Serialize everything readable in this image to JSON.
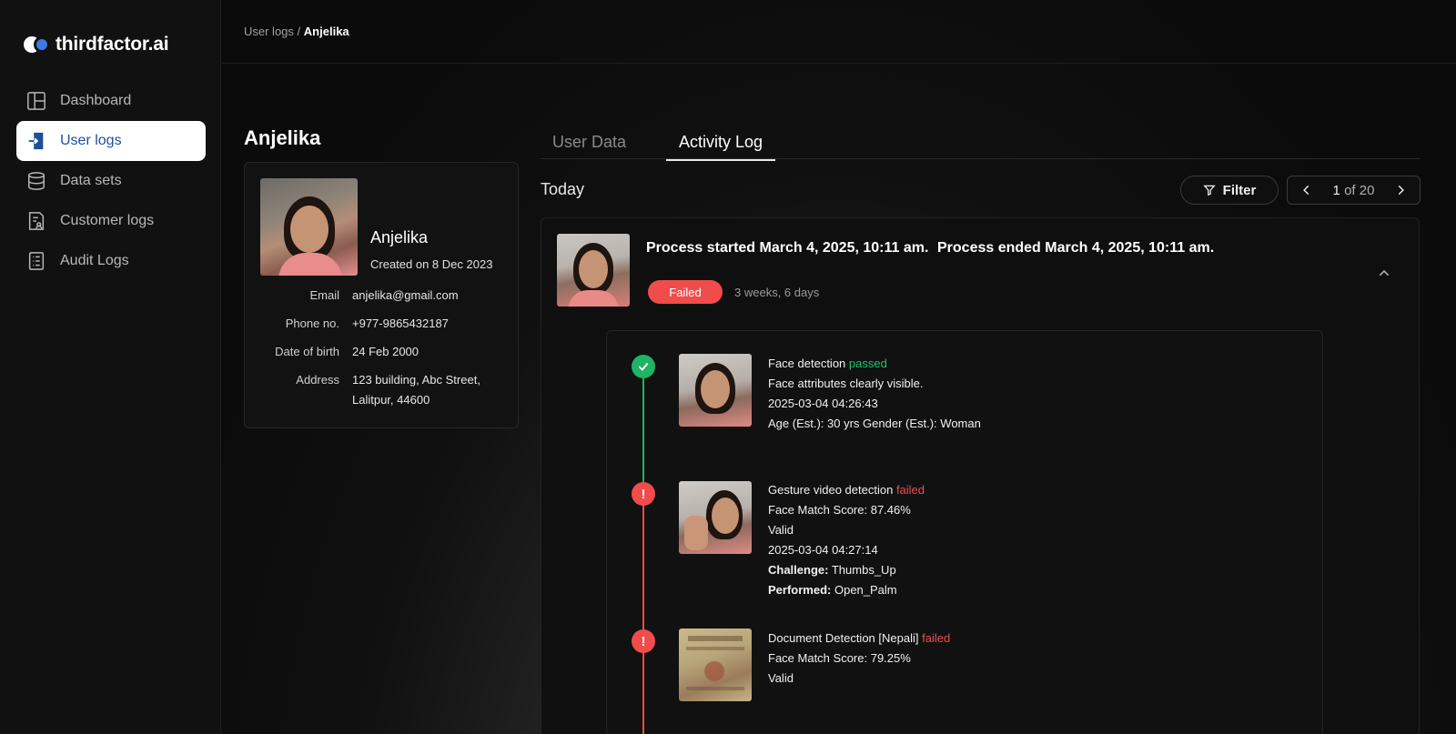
{
  "brand": {
    "name": "thirdfactor.ai"
  },
  "sidebar": {
    "items": [
      {
        "label": "Dashboard",
        "icon": "dashboard-icon",
        "active": false
      },
      {
        "label": "User logs",
        "icon": "login-icon",
        "active": true
      },
      {
        "label": "Data sets",
        "icon": "database-icon",
        "active": false
      },
      {
        "label": "Customer logs",
        "icon": "customer-logs-icon",
        "active": false
      },
      {
        "label": "Audit Logs",
        "icon": "audit-logs-icon",
        "active": false
      }
    ]
  },
  "breadcrumb": {
    "parent": "User logs",
    "separator": "/",
    "current": "Anjelika"
  },
  "user": {
    "title": "Anjelika",
    "name": "Anjelika",
    "created": "Created on 8 Dec 2023",
    "fields": [
      {
        "label": "Email",
        "value": "anjelika@gmail.com"
      },
      {
        "label": "Phone no.",
        "value": "+977-9865432187"
      },
      {
        "label": "Date of birth",
        "value": "24 Feb 2000"
      },
      {
        "label": "Address",
        "value": "123 building, Abc Street,",
        "value2": "Lalitpur, 44600"
      }
    ]
  },
  "tabs": {
    "user_data": "User Data",
    "activity_log": "Activity Log",
    "active": "activity_log"
  },
  "activity": {
    "section": "Today",
    "filter_label": "Filter",
    "pager": {
      "current": "1",
      "of_text": "of 20"
    },
    "process": {
      "started": "Process started March 4, 2025, 10:11 am.",
      "ended": "Process ended March 4, 2025, 10:11 am.",
      "status": "Failed",
      "duration": "3 weeks, 6 days"
    },
    "steps": [
      {
        "title": "Face detection",
        "result": "passed",
        "lines": [
          "Face attributes clearly visible.",
          "2025-03-04 04:26:43",
          "Age (Est.): 30 yrs Gender (Est.): Woman"
        ]
      },
      {
        "title": "Gesture video detection",
        "result": "failed",
        "lines": [
          "Face Match Score: 87.46%",
          "Valid",
          "2025-03-04 04:27:14"
        ],
        "challenge_label": "Challenge:",
        "challenge_value": "Thumbs_Up",
        "performed_label": "Performed:",
        "performed_value": "Open_Palm"
      },
      {
        "title": "Document Detection [Nepali]",
        "result": "failed",
        "lines": [
          "Face Match Score: 79.25%",
          "Valid"
        ]
      }
    ]
  },
  "colors": {
    "accent_blue": "#1d4f9a",
    "pass_green": "#1fb365",
    "fail_red": "#f04c4c"
  }
}
